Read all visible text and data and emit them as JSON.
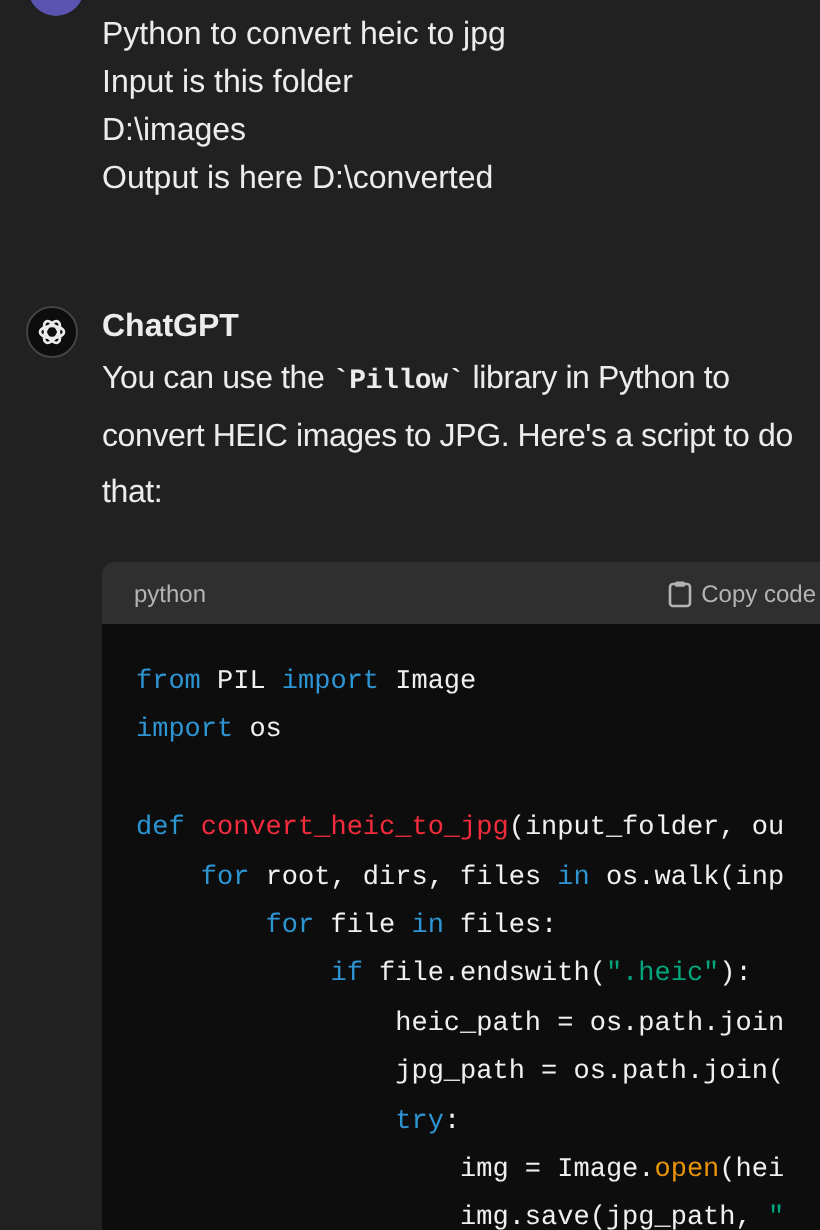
{
  "user_message": {
    "lines": [
      "Python to convert heic to jpg",
      "Input is this folder",
      "D:\\images",
      "Output is here D:\\converted"
    ]
  },
  "assistant": {
    "name": "ChatGPT",
    "paragraph": [
      {
        "kind": "text",
        "text": "You can use the "
      },
      {
        "kind": "code",
        "text": "`Pillow`"
      },
      {
        "kind": "text",
        "text": " library in Python to convert HEIC images to JPG. Here's a script to do that:"
      }
    ],
    "code_block": {
      "language": "python",
      "copy_label": "Copy code",
      "lines": [
        {
          "kind": "code",
          "tokens": [
            {
              "kind": "keyword",
              "text": "from"
            },
            {
              "kind": "plain",
              "text": " PIL "
            },
            {
              "kind": "keyword",
              "text": "import"
            },
            {
              "kind": "plain",
              "text": " Image"
            }
          ]
        },
        {
          "kind": "code",
          "tokens": [
            {
              "kind": "keyword",
              "text": "import"
            },
            {
              "kind": "plain",
              "text": " os"
            }
          ]
        },
        {
          "kind": "blank"
        },
        {
          "kind": "code",
          "tokens": [
            {
              "kind": "keyword",
              "text": "def "
            },
            {
              "kind": "function",
              "text": "convert_heic_to_jpg"
            },
            {
              "kind": "plain",
              "text": "(input_folder, ou"
            }
          ]
        },
        {
          "kind": "code",
          "tokens": [
            {
              "kind": "keyword",
              "text": "    for"
            },
            {
              "kind": "plain",
              "text": " root, dirs, files "
            },
            {
              "kind": "keyword",
              "text": "in"
            },
            {
              "kind": "plain",
              "text": " os.walk(inp"
            }
          ]
        },
        {
          "kind": "code",
          "tokens": [
            {
              "kind": "keyword",
              "text": "        for"
            },
            {
              "kind": "plain",
              "text": " file "
            },
            {
              "kind": "keyword",
              "text": "in"
            },
            {
              "kind": "plain",
              "text": " files:"
            }
          ]
        },
        {
          "kind": "code",
          "tokens": [
            {
              "kind": "keyword",
              "text": "            if"
            },
            {
              "kind": "plain",
              "text": " file.endswith("
            },
            {
              "kind": "string",
              "text": "\".heic\""
            },
            {
              "kind": "plain",
              "text": "):"
            }
          ]
        },
        {
          "kind": "code",
          "tokens": [
            {
              "kind": "plain",
              "text": "                heic_path = os.path.join"
            }
          ]
        },
        {
          "kind": "code",
          "tokens": [
            {
              "kind": "plain",
              "text": "                jpg_path = os.path.join("
            }
          ]
        },
        {
          "kind": "code",
          "tokens": [
            {
              "kind": "keyword",
              "text": "                try"
            },
            {
              "kind": "plain",
              "text": ":"
            }
          ]
        },
        {
          "kind": "code",
          "tokens": [
            {
              "kind": "plain",
              "text": "                    img = Image."
            },
            {
              "kind": "builtin",
              "text": "open"
            },
            {
              "kind": "plain",
              "text": "(hei"
            }
          ]
        },
        {
          "kind": "code",
          "tokens": [
            {
              "kind": "plain",
              "text": "                    img.save(jpg_path, "
            },
            {
              "kind": "string",
              "text": "\""
            }
          ]
        }
      ]
    }
  }
}
